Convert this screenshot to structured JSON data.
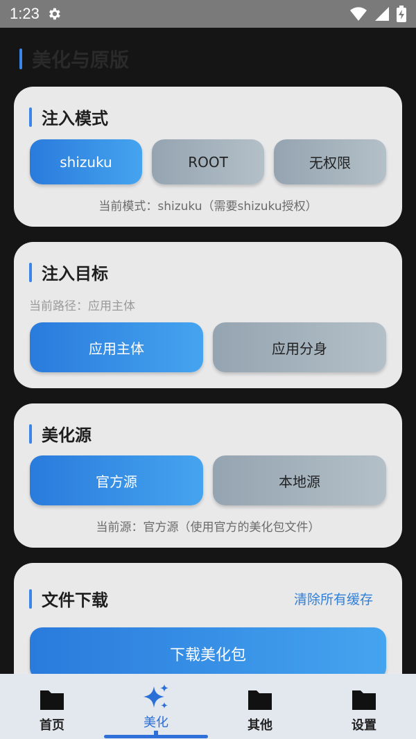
{
  "status_bar": {
    "time": "1:23"
  },
  "page": {
    "section_title": "美化与原版"
  },
  "inject_mode": {
    "title": "注入模式",
    "options": [
      "shizuku",
      "ROOT",
      "无权限"
    ],
    "selected": "shizuku",
    "note": "当前模式：shizuku（需要shizuku授权）"
  },
  "inject_target": {
    "title": "注入目标",
    "path_note": "当前路径：应用主体",
    "options": [
      "应用主体",
      "应用分身"
    ],
    "selected": "应用主体"
  },
  "beautify_source": {
    "title": "美化源",
    "options": [
      "官方源",
      "本地源"
    ],
    "selected": "官方源",
    "note": "当前源：官方源（使用官方的美化包文件）"
  },
  "file_download": {
    "title": "文件下载",
    "clear_cache_label": "清除所有缓存",
    "download_label": "下载美化包"
  },
  "bottom_nav": {
    "items": [
      "首页",
      "美化",
      "其他",
      "设置"
    ],
    "active": "美化"
  },
  "colors": {
    "accent": "#3a86e8",
    "active_nav": "#2a6fd6",
    "card_bg": "#e9e9ea"
  }
}
